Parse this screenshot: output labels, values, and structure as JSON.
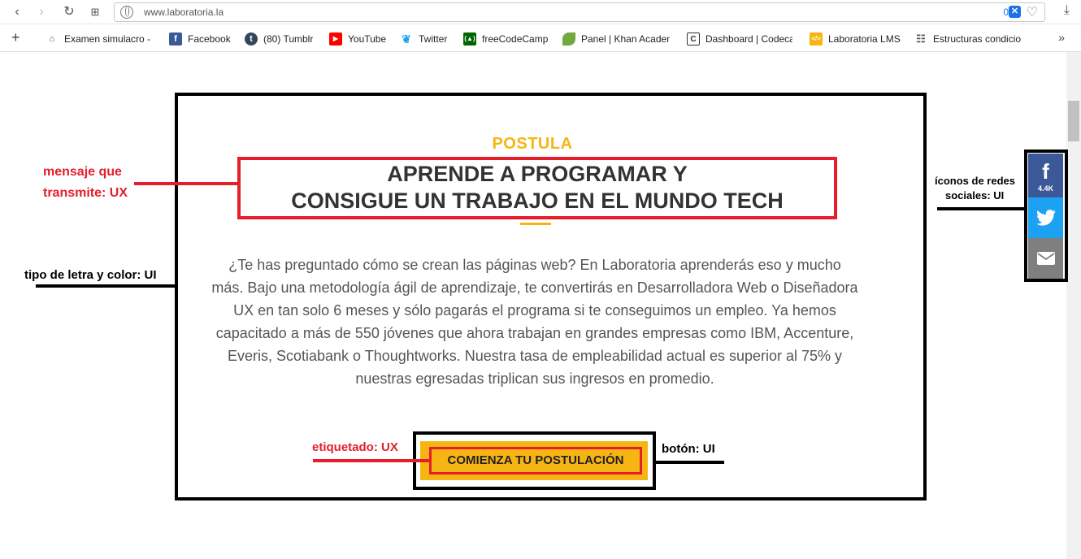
{
  "browser": {
    "url": "www.laboratoria.la",
    "badge_count": "0",
    "badge_label": "✕"
  },
  "bookmarks": [
    {
      "label": "Examen simulacro - I",
      "icon": "graduation-cap-icon",
      "color": "#555555"
    },
    {
      "label": "Facebook",
      "icon": "facebook-icon",
      "color": "#3b5998"
    },
    {
      "label": "(80) Tumblr",
      "icon": "tumblr-icon",
      "color": "#35465c"
    },
    {
      "label": "YouTube",
      "icon": "youtube-icon",
      "color": "#ff0000"
    },
    {
      "label": "Twitter",
      "icon": "twitter-icon",
      "color": "#1da1f2"
    },
    {
      "label": "freeCodeCamp",
      "icon": "freecodecamp-icon",
      "color": "#006400"
    },
    {
      "label": "Panel | Khan Academ",
      "icon": "leaf-icon",
      "color": "#72a83c"
    },
    {
      "label": "Dashboard | Codeca",
      "icon": "codecademy-icon",
      "color": "#333333"
    },
    {
      "label": "Laboratoria LMS",
      "icon": "laboratoria-icon",
      "color": "#f7b514"
    },
    {
      "label": "Estructuras condicio",
      "icon": "book-icon",
      "color": "#555555"
    }
  ],
  "content": {
    "kicker": "POSTULA",
    "title_line1": "APRENDE A PROGRAMAR Y",
    "title_line2": "CONSIGUE UN TRABAJO EN EL MUNDO TECH",
    "body": "¿Te has preguntado cómo se crean las páginas web? En Laboratoria aprenderás eso y mucho más. Bajo una metodología ágil de aprendizaje, te convertirás en Desarrolladora Web o Diseñadora UX en tan solo 6 meses y sólo pagarás el programa si te conseguimos un empleo. Ya hemos capacitado a más de 550 jóvenes que ahora trabajan en grandes empresas como IBM, Accenture, Everis, Scotiabank o Thoughtworks. Nuestra tasa de empleabilidad actual es superior al 75% y nuestras egresadas triplican sus ingresos en promedio.",
    "cta_label": "COMIENZA TU POSTULACIÓN"
  },
  "annotations": {
    "message_line1": "mensaje que",
    "message_line2": "transmite: UX",
    "font_color": "tipo de letra y color: UI",
    "labeled": "etiquetado: UX",
    "button": "botón: UI",
    "social_line1": "íconos de redes",
    "social_line2": "sociales: UI"
  },
  "social": {
    "facebook_count": "4.4K"
  },
  "colors": {
    "accent": "#f7b514",
    "annotation_red": "#e51e2b",
    "facebook": "#3b5998",
    "twitter": "#1da1f2",
    "email": "#7f7f7f"
  }
}
